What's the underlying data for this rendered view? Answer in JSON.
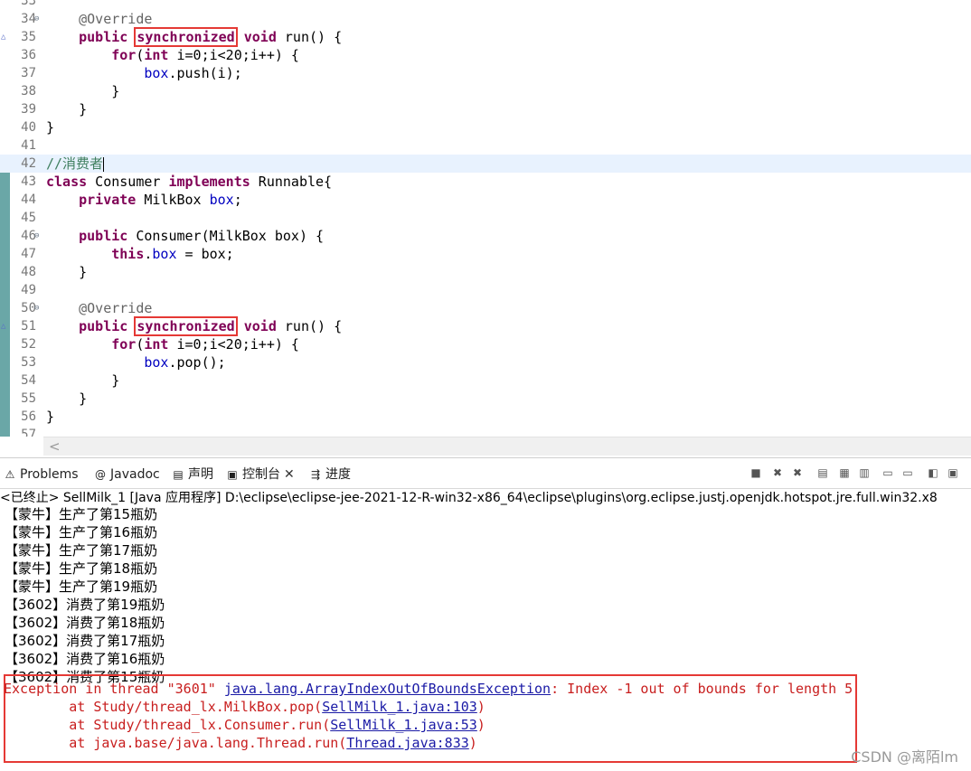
{
  "editor": {
    "lines": [
      {
        "num": "33",
        "fold": "",
        "ov": "",
        "segs": []
      },
      {
        "num": "34",
        "fold": "⊖",
        "ov": "",
        "segs": [
          {
            "t": "    "
          },
          {
            "t": "@Override",
            "c": "ann"
          }
        ]
      },
      {
        "num": "35",
        "fold": "",
        "ov": "△",
        "segs": [
          {
            "t": "    "
          },
          {
            "t": "public",
            "c": "kw"
          },
          {
            "t": " "
          },
          {
            "t": "synchronized",
            "c": "kw",
            "hl": true
          },
          {
            "t": " "
          },
          {
            "t": "void",
            "c": "kw"
          },
          {
            "t": " run() {"
          }
        ]
      },
      {
        "num": "36",
        "fold": "",
        "ov": "",
        "segs": [
          {
            "t": "        "
          },
          {
            "t": "for",
            "c": "kw"
          },
          {
            "t": "("
          },
          {
            "t": "int",
            "c": "kw"
          },
          {
            "t": " i=0;i<20;i++) {"
          }
        ]
      },
      {
        "num": "37",
        "fold": "",
        "ov": "",
        "segs": [
          {
            "t": "            "
          },
          {
            "t": "box",
            "c": "fld"
          },
          {
            "t": ".push(i);"
          }
        ]
      },
      {
        "num": "38",
        "fold": "",
        "ov": "",
        "segs": [
          {
            "t": "        }"
          }
        ]
      },
      {
        "num": "39",
        "fold": "",
        "ov": "",
        "segs": [
          {
            "t": "    }"
          }
        ]
      },
      {
        "num": "40",
        "fold": "",
        "ov": "",
        "segs": [
          {
            "t": "}"
          }
        ]
      },
      {
        "num": "41",
        "fold": "",
        "ov": "",
        "segs": []
      },
      {
        "num": "42",
        "fold": "",
        "ov": "",
        "current": true,
        "caret": true,
        "segs": [
          {
            "t": "//消费者",
            "c": "cmt"
          }
        ]
      },
      {
        "num": "43",
        "fold": "",
        "ov": "",
        "segs": [
          {
            "t": "class",
            "c": "kw"
          },
          {
            "t": " Consumer "
          },
          {
            "t": "implements",
            "c": "kw"
          },
          {
            "t": " Runnable{"
          }
        ]
      },
      {
        "num": "44",
        "fold": "",
        "ov": "",
        "segs": [
          {
            "t": "    "
          },
          {
            "t": "private",
            "c": "kw"
          },
          {
            "t": " MilkBox "
          },
          {
            "t": "box",
            "c": "fld"
          },
          {
            "t": ";"
          }
        ]
      },
      {
        "num": "45",
        "fold": "",
        "ov": "",
        "segs": []
      },
      {
        "num": "46",
        "fold": "⊖",
        "ov": "",
        "segs": [
          {
            "t": "    "
          },
          {
            "t": "public",
            "c": "kw"
          },
          {
            "t": " Consumer(MilkBox box) {"
          }
        ]
      },
      {
        "num": "47",
        "fold": "",
        "ov": "",
        "segs": [
          {
            "t": "        "
          },
          {
            "t": "this",
            "c": "kw"
          },
          {
            "t": "."
          },
          {
            "t": "box",
            "c": "fld"
          },
          {
            "t": " = box;"
          }
        ]
      },
      {
        "num": "48",
        "fold": "",
        "ov": "",
        "segs": [
          {
            "t": "    }"
          }
        ]
      },
      {
        "num": "49",
        "fold": "",
        "ov": "",
        "segs": []
      },
      {
        "num": "50",
        "fold": "⊖",
        "ov": "",
        "segs": [
          {
            "t": "    "
          },
          {
            "t": "@Override",
            "c": "ann"
          }
        ]
      },
      {
        "num": "51",
        "fold": "",
        "ov": "△",
        "segs": [
          {
            "t": "    "
          },
          {
            "t": "public",
            "c": "kw"
          },
          {
            "t": " "
          },
          {
            "t": "synchronized",
            "c": "kw",
            "hl": true
          },
          {
            "t": " "
          },
          {
            "t": "void",
            "c": "kw"
          },
          {
            "t": " run() {"
          }
        ]
      },
      {
        "num": "52",
        "fold": "",
        "ov": "",
        "segs": [
          {
            "t": "        "
          },
          {
            "t": "for",
            "c": "kw"
          },
          {
            "t": "("
          },
          {
            "t": "int",
            "c": "kw"
          },
          {
            "t": " i=0;i<20;i++) {"
          }
        ]
      },
      {
        "num": "53",
        "fold": "",
        "ov": "",
        "segs": [
          {
            "t": "            "
          },
          {
            "t": "box",
            "c": "fld"
          },
          {
            "t": ".pop();"
          }
        ]
      },
      {
        "num": "54",
        "fold": "",
        "ov": "",
        "segs": [
          {
            "t": "        }"
          }
        ]
      },
      {
        "num": "55",
        "fold": "",
        "ov": "",
        "segs": [
          {
            "t": "    }"
          }
        ]
      },
      {
        "num": "56",
        "fold": "",
        "ov": "",
        "segs": [
          {
            "t": "}"
          }
        ]
      },
      {
        "num": "57",
        "fold": "",
        "ov": "",
        "segs": []
      }
    ]
  },
  "scroll": {
    "left_arrow": "<"
  },
  "panel": {
    "tabs": [
      {
        "label": "Problems",
        "icon": "problems-icon",
        "glyph": "⚠"
      },
      {
        "label": "Javadoc",
        "icon": "javadoc-icon",
        "glyph": "@"
      },
      {
        "label": "声明",
        "icon": "declaration-icon",
        "glyph": "▤"
      },
      {
        "label": "控制台",
        "icon": "console-icon",
        "glyph": "▣",
        "active": true,
        "close": "✕"
      },
      {
        "label": "进度",
        "icon": "progress-icon",
        "glyph": "⇶"
      }
    ],
    "toolbar_icons": [
      "terminate-icon",
      "remove-launch-icon",
      "remove-all-icon",
      "clear-console-icon",
      "scroll-lock-icon",
      "word-wrap-icon",
      "show-on-output-icon",
      "show-on-error-icon",
      "pin-console-icon",
      "open-console-icon"
    ],
    "status": "<已终止> SellMilk_1 [Java 应用程序] D:\\eclipse\\eclipse-jee-2021-12-R-win32-x86_64\\eclipse\\plugins\\org.eclipse.justj.openjdk.hotspot.jre.full.win32.x8"
  },
  "console": {
    "output": [
      "【蒙牛】生产了第15瓶奶",
      "【蒙牛】生产了第16瓶奶",
      "【蒙牛】生产了第17瓶奶",
      "【蒙牛】生产了第18瓶奶",
      "【蒙牛】生产了第19瓶奶",
      "【3602】消费了第19瓶奶",
      "【3602】消费了第18瓶奶",
      "【3602】消费了第17瓶奶",
      "【3602】消费了第16瓶奶",
      "【3602】消费了第15瓶奶"
    ],
    "error": [
      [
        {
          "t": "Exception in thread \"3601\" "
        },
        {
          "t": "java.lang.ArrayIndexOutOfBoundsException",
          "link": true
        },
        {
          "t": ": Index -1 out of bounds for length 5"
        }
      ],
      [
        {
          "t": "        at Study/thread_lx.MilkBox.pop("
        },
        {
          "t": "SellMilk_1.java:103",
          "link": true
        },
        {
          "t": ")"
        }
      ],
      [
        {
          "t": "        at Study/thread_lx.Consumer.run("
        },
        {
          "t": "SellMilk_1.java:53",
          "link": true
        },
        {
          "t": ")"
        }
      ],
      [
        {
          "t": "        at java.base/java.lang.Thread.run("
        },
        {
          "t": "Thread.java:833",
          "link": true
        },
        {
          "t": ")"
        }
      ]
    ]
  },
  "watermark": "CSDN @离陌lm"
}
